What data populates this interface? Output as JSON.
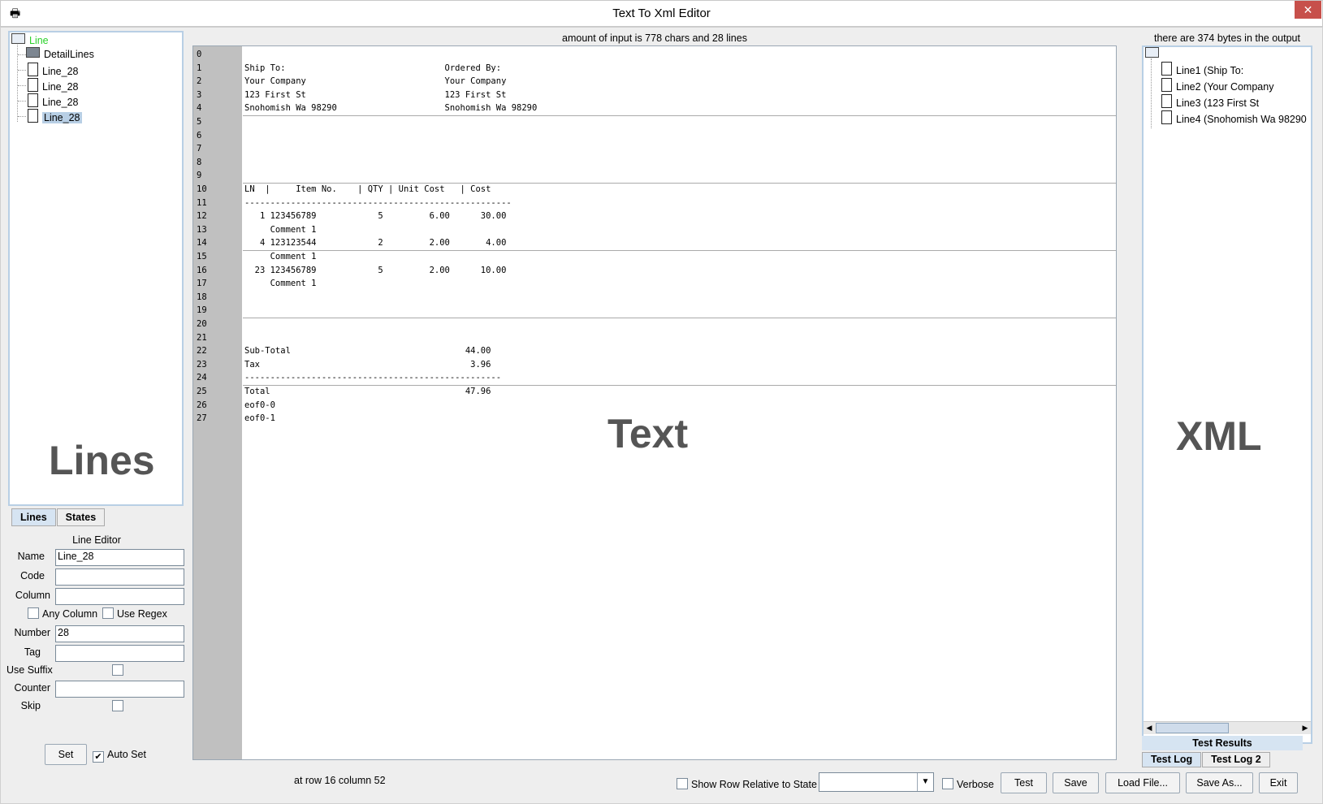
{
  "window": {
    "title": "Text To Xml Editor",
    "close_label": "✕"
  },
  "left_tree": {
    "root": "Line",
    "items": [
      "DetailLines",
      "Line_28",
      "Line_28",
      "Line_28",
      "Line_28"
    ]
  },
  "left_watermark": "Lines",
  "left_tabs": [
    "Lines",
    "States"
  ],
  "line_editor": {
    "title": "Line Editor",
    "name_label": "Name",
    "name_value": "Line_28",
    "code_label": "Code",
    "code_value": "",
    "column_label": "Column",
    "column_value": "",
    "any_column_label": "Any Column",
    "use_regex_label": "Use Regex",
    "number_label": "Number",
    "number_value": "28",
    "tag_label": "Tag",
    "tag_value": "",
    "use_suffix_label": "Use Suffix",
    "counter_label": "Counter",
    "counter_value": "",
    "skip_label": "Skip",
    "set_button": "Set",
    "auto_set_label": "Auto Set",
    "auto_set_checked": true
  },
  "text_panel": {
    "header": "amount of input is 778 chars and 28 lines",
    "watermark": "Text",
    "lines": [
      "",
      "Ship To:                               Ordered By:",
      "Your Company                           Your Company",
      "123 First St                           123 First St",
      "Snohomish Wa 98290                     Snohomish Wa 98290",
      "",
      "",
      "",
      "",
      "",
      "LN  |     Item No.    | QTY | Unit Cost   | Cost",
      "----------------------------------------------------",
      "   1 123456789            5         6.00      30.00",
      "     Comment 1",
      "   4 123123544            2         2.00       4.00",
      "     Comment 1",
      "  23 123456789            5         2.00      10.00",
      "     Comment 1",
      "",
      "",
      "",
      "",
      "Sub-Total                                  44.00",
      "Tax                                         3.96",
      "--------------------------------------------------",
      "Total                                      47.96",
      "eof0-0",
      "eof0-1"
    ]
  },
  "xml_panel": {
    "header": "there are 374 bytes in the output",
    "watermark": "XML",
    "items": [
      "Line1 (Ship To:",
      "Line2 (Your Company",
      "Line3 (123 First St",
      "Line4 (Snohomish Wa 98290"
    ]
  },
  "right_tabs": {
    "results": "Test Results",
    "log1": "Test Log",
    "log2": "Test Log 2"
  },
  "statusbar": {
    "position": "at row 16 column 52",
    "show_row_label": "Show Row Relative to State",
    "state_select_value": "",
    "verbose_label": "Verbose",
    "test_button": "Test",
    "save_button": "Save",
    "load_button": "Load File...",
    "save_as_button": "Save As...",
    "exit_button": "Exit"
  }
}
